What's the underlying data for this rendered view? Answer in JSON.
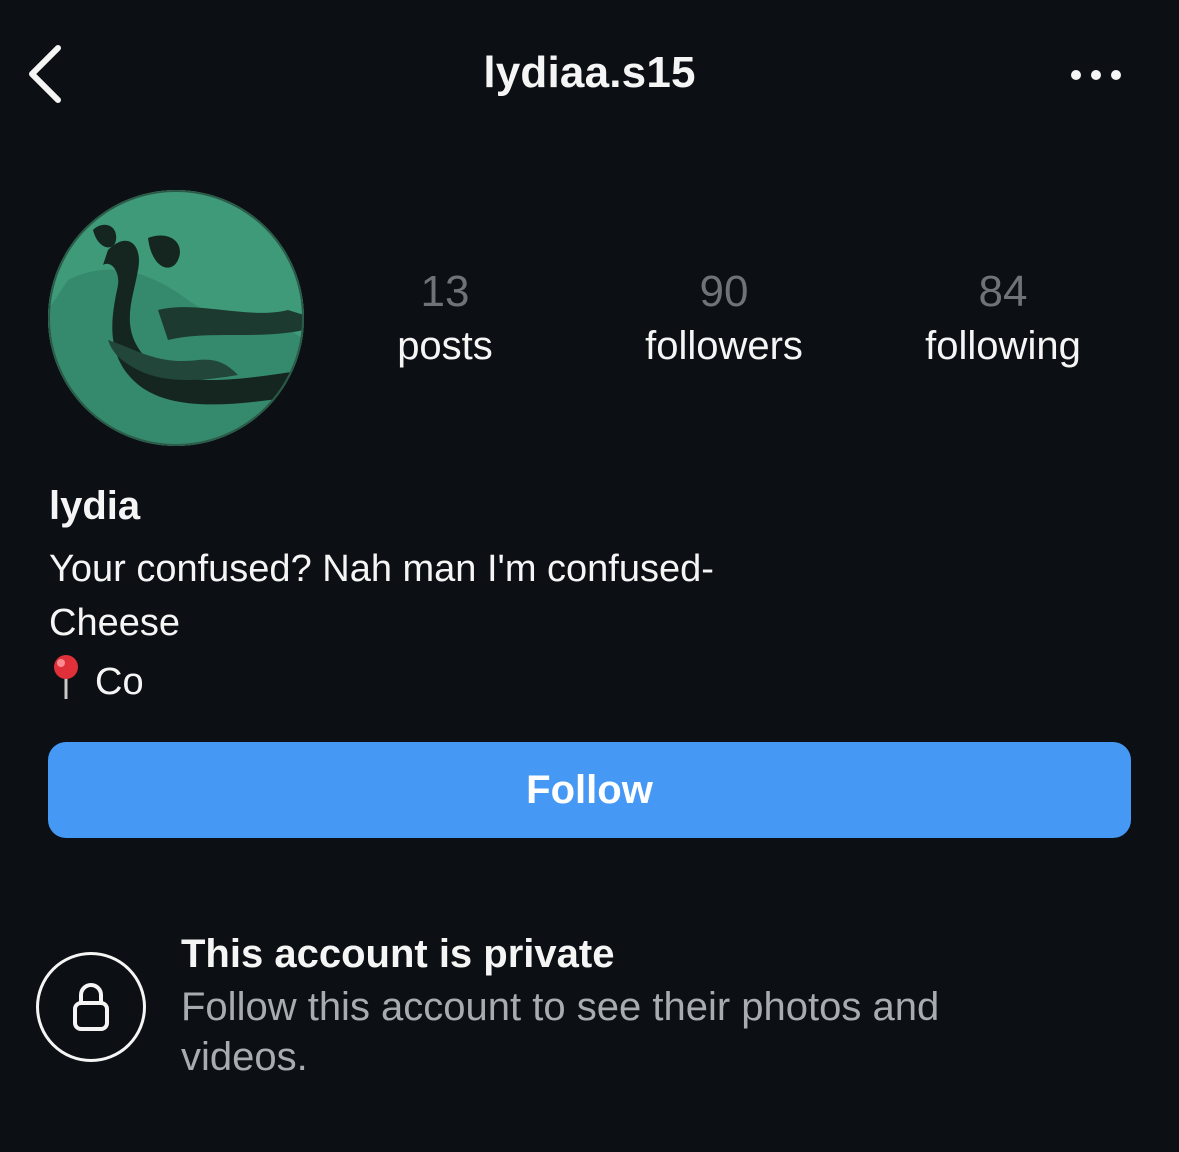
{
  "header": {
    "username": "lydiaa.s15",
    "back_icon": "chevron-left-icon",
    "more_icon": "more-horizontal-icon"
  },
  "profile": {
    "avatar_alt": "profile picture",
    "display_name": "lydia",
    "bio_lines": [
      "Your confused? Nah man I'm confused-",
      "Cheese",
      "Co"
    ],
    "location_icon": "round-pushpin-icon"
  },
  "stats": [
    {
      "count": "13",
      "label": "posts"
    },
    {
      "count": "90",
      "label": "followers"
    },
    {
      "count": "84",
      "label": "following"
    }
  ],
  "actions": {
    "follow_label": "Follow"
  },
  "private_notice": {
    "icon": "lock-icon",
    "title": "This account is private",
    "description": "Follow this account to see their photos and videos."
  },
  "colors": {
    "background": "#0c1014",
    "follow_button": "#4599f5",
    "muted_text": "#a8acb1",
    "stat_count": "#6e7378"
  }
}
